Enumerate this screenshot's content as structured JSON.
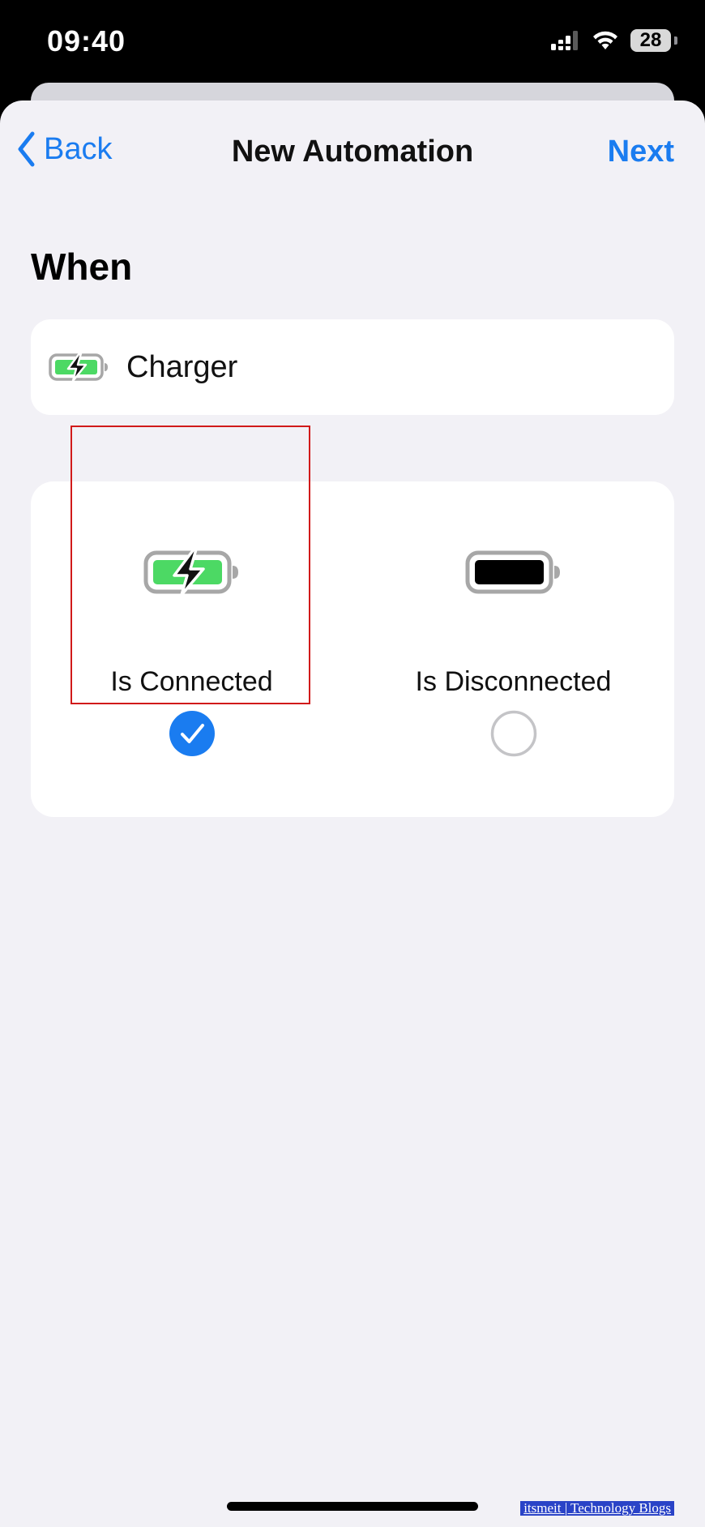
{
  "status_bar": {
    "time": "09:40",
    "battery_level": "28",
    "icons": [
      "cellular-signal-icon",
      "wifi-icon",
      "battery-icon"
    ]
  },
  "nav": {
    "back_label": "Back",
    "title": "New Automation",
    "next_label": "Next"
  },
  "section": {
    "heading": "When"
  },
  "trigger": {
    "label": "Charger",
    "icon": "charging-battery-icon"
  },
  "options": [
    {
      "label": "Is Connected",
      "icon": "charging-battery-icon",
      "selected": true
    },
    {
      "label": "Is Disconnected",
      "icon": "battery-icon",
      "selected": false
    }
  ],
  "watermark": {
    "text": "itsmeit | Technology Blogs"
  },
  "colors": {
    "accent": "#1a7cf0",
    "battery_green": "#4cd964",
    "background": "#f2f1f6",
    "highlight": "#d11a1a"
  }
}
